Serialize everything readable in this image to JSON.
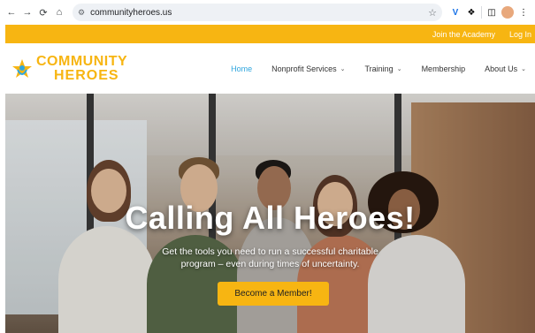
{
  "browser": {
    "url": "communityheroes.us",
    "icons": [
      "back-arrow-icon",
      "forward-arrow-icon",
      "reload-icon",
      "home-icon",
      "site-info-icon",
      "bookmark-star-icon",
      "extension-v-icon",
      "extensions-puzzle-icon",
      "sidepanel-icon",
      "profile-avatar-icon",
      "menu-dots-icon"
    ]
  },
  "topbar": {
    "links": [
      "Join the Academy",
      "Log In"
    ],
    "color": "#f7b512"
  },
  "logo": {
    "line1": "COMMUNITY",
    "line2": "HEROES"
  },
  "nav": {
    "items": [
      {
        "label": "Home",
        "active": true
      },
      {
        "label": "Nonprofit Services",
        "dropdown": true
      },
      {
        "label": "Training",
        "dropdown": true
      },
      {
        "label": "Membership"
      },
      {
        "label": "About Us",
        "dropdown": true
      }
    ],
    "active_color": "#2fa6de"
  },
  "hero": {
    "title": "Calling All Heroes!",
    "subtitle_line1": "Get the tools you need to run a successful charitable",
    "subtitle_line2": "program – even during times of uncertainty.",
    "cta": "Become a Member!"
  }
}
